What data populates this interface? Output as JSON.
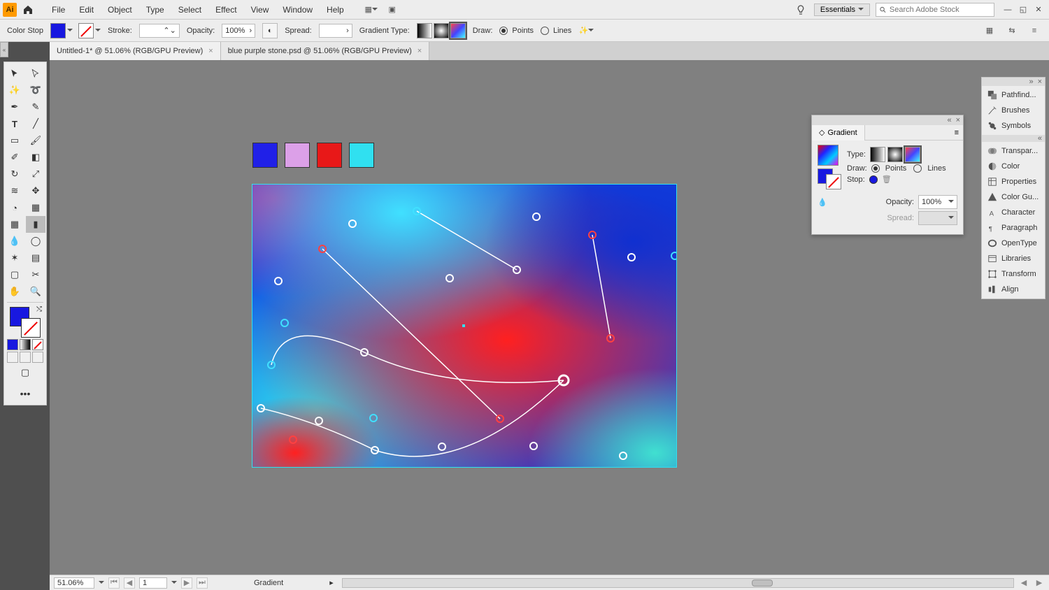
{
  "app": {
    "logo_text": "Ai"
  },
  "menubar": {
    "items": [
      "File",
      "Edit",
      "Object",
      "Type",
      "Select",
      "Effect",
      "View",
      "Window",
      "Help"
    ],
    "workspace": "Essentials",
    "search_placeholder": "Search Adobe Stock"
  },
  "controlbar": {
    "label": "Color Stop",
    "stroke_label": "Stroke:",
    "opacity_label": "Opacity:",
    "opacity_value": "100%",
    "spread_label": "Spread:",
    "gradient_type_label": "Gradient Type:",
    "draw_label": "Draw:",
    "draw_points": "Points",
    "draw_lines": "Lines"
  },
  "tabs": [
    {
      "title": "Untitled-1* @ 51.06% (RGB/GPU Preview)",
      "active": true
    },
    {
      "title": "blue purple stone.psd @ 51.06% (RGB/GPU Preview)",
      "active": false
    }
  ],
  "gradient_panel": {
    "title": "Gradient",
    "type_label": "Type:",
    "draw_label": "Draw:",
    "draw_points": "Points",
    "draw_lines": "Lines",
    "stop_label": "Stop:",
    "opacity_label": "Opacity:",
    "opacity_value": "100%",
    "spread_label": "Spread:"
  },
  "right_dock": {
    "group1": [
      "Pathfind...",
      "Brushes",
      "Symbols"
    ],
    "group2": [
      "Transpar...",
      "Color",
      "Properties",
      "Color Gu...",
      "Character",
      "Paragraph",
      "OpenType",
      "Libraries",
      "Transform",
      "Align"
    ]
  },
  "statusbar": {
    "zoom": "51.06%",
    "artboard_num": "1",
    "tool": "Gradient"
  },
  "swatches": {
    "colors": [
      "#2020e8",
      "#dca0e8",
      "#e81818",
      "#30e0f0"
    ]
  }
}
